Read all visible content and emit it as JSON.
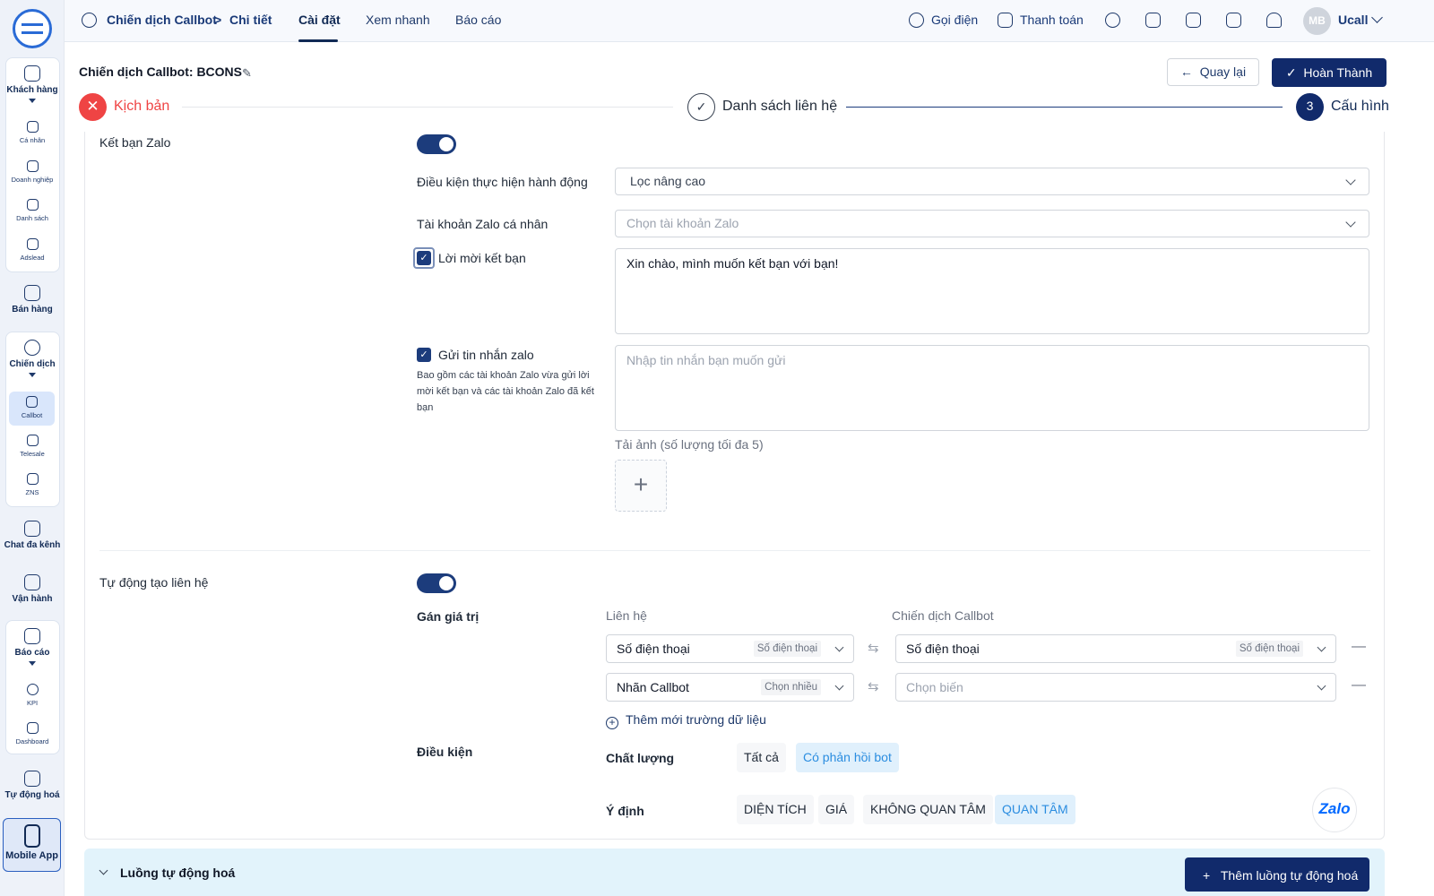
{
  "sidebar": {
    "groups": [
      {
        "label": "Khách hàng",
        "sub": [
          "Cá nhân",
          "Doanh nghiệp",
          "Danh sách",
          "Adslead"
        ]
      },
      {
        "label": "Bán hàng"
      },
      {
        "label": "Chiến dịch",
        "sub": [
          "Callbot",
          "Telesale",
          "ZNS"
        ]
      },
      {
        "label": "Chat đa kênh"
      },
      {
        "label": "Vận hành"
      },
      {
        "label": "Báo cáo",
        "sub": [
          "KPI",
          "Dashboard"
        ]
      },
      {
        "label": "Tự động hoá"
      }
    ],
    "mobile_app": "Mobile App",
    "active_sub": "Callbot"
  },
  "topbar": {
    "breadcrumb": [
      "Chiến dịch Callbot",
      "Chi tiết"
    ],
    "tabs": [
      "Cài đặt",
      "Xem nhanh",
      "Báo cáo"
    ],
    "active_tab": "Cài đặt",
    "call": "Gọi điện",
    "payment": "Thanh toán",
    "avatar": "MB",
    "user": "Ucall"
  },
  "header": {
    "title": "Chiến dịch Callbot: BCONS",
    "back": "Quay lại",
    "done": "Hoàn Thành"
  },
  "steps": [
    {
      "label": "Kịch bản",
      "state": "error"
    },
    {
      "label": "Danh sách liên hệ",
      "state": "done"
    },
    {
      "num": "3",
      "label": "Cấu hình",
      "state": "active"
    }
  ],
  "zalo_friend": {
    "label": "Kết bạn Zalo",
    "enabled": true,
    "condition_label": "Điều kiện thực hiện hành động",
    "condition_value": "Lọc nâng cao",
    "account_label": "Tài khoản Zalo cá nhân",
    "account_placeholder": "Chọn tài khoản Zalo",
    "invite_label": "Lời mời kết bạn",
    "invite_checked": true,
    "invite_text": "Xin chào, mình muốn kết bạn với bạn!",
    "send_label": "Gửi tin nhắn zalo",
    "send_checked": true,
    "send_hint": "Bao gồm các tài khoản Zalo vừa gửi lời mời kết bạn và các tài khoản Zalo đã kết bạn",
    "send_placeholder": "Nhập tin nhắn bạn muốn gửi",
    "upload_label": "Tải ảnh (số lượng tối đa 5)"
  },
  "auto_contact": {
    "label": "Tự động tạo liên hệ",
    "enabled": true,
    "assign_label": "Gán giá trị",
    "col_left": "Liên hệ",
    "col_right": "Chiến dịch Callbot",
    "rows": [
      {
        "left": "Số điện thoại",
        "left_tag": "Số điện thoại",
        "right": "Số điện thoại",
        "right_tag": "Số điện thoại"
      },
      {
        "left": "Nhãn Callbot",
        "left_tag": "Chọn nhiều",
        "right_placeholder": "Chọn biến"
      }
    ],
    "add_field": "Thêm mới trường dữ liệu",
    "condition_label": "Điều kiện",
    "quality_label": "Chất lượng",
    "quality_options": [
      "Tất cả",
      "Có phản hồi bot"
    ],
    "quality_selected": "Có phản hồi bot",
    "intent_label": "Ý định",
    "intent_options": [
      "DIỆN TÍCH",
      "GIÁ",
      "KHÔNG QUAN TÂM",
      "QUAN TÂM"
    ],
    "intent_selected": "QUAN TÂM"
  },
  "automation": {
    "title": "Luồng tự động hoá",
    "add_button": "Thêm luồng tự động hoá"
  },
  "zalo_badge": "Zalo",
  "colors": {
    "primary": "#112a6b",
    "accent": "#2b8de0",
    "error": "#ef4444"
  }
}
